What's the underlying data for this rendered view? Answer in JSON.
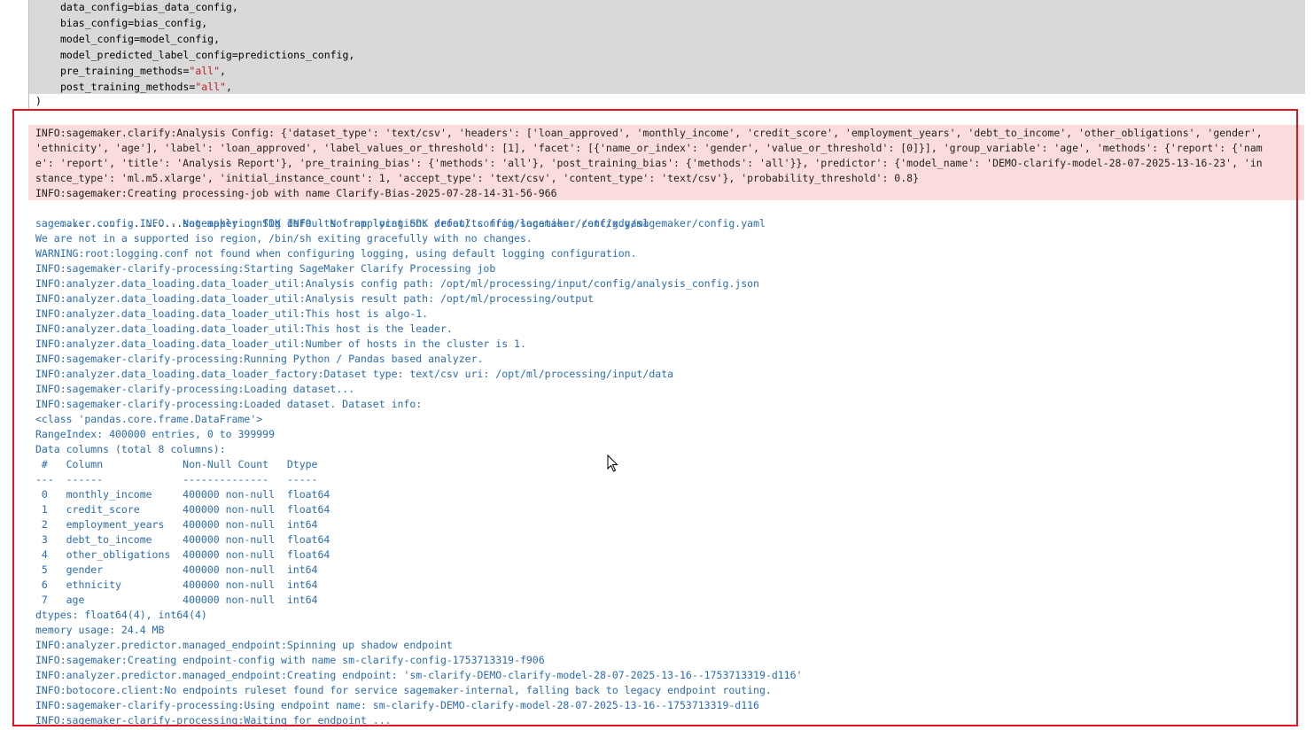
{
  "code_cell": {
    "lines": [
      {
        "prefix": "data_config=bias_data_config,",
        "str": "",
        "suffix": ""
      },
      {
        "prefix": "bias_config=bias_config,",
        "str": "",
        "suffix": ""
      },
      {
        "prefix": "model_config=model_config,",
        "str": "",
        "suffix": ""
      },
      {
        "prefix": "model_predicted_label_config=predictions_config,",
        "str": "",
        "suffix": ""
      },
      {
        "prefix": "pre_training_methods=",
        "str": "\"all\"",
        "suffix": ","
      },
      {
        "prefix": "post_training_methods=",
        "str": "\"all\"",
        "suffix": ","
      }
    ],
    "closing": ")"
  },
  "output": {
    "stderr_lines": [
      "INFO:sagemaker.clarify:Analysis Config: {'dataset_type': 'text/csv', 'headers': ['loan_approved', 'monthly_income', 'credit_score', 'employment_years', 'debt_to_income', 'other_obligations', 'gender',",
      "'ethnicity', 'age'], 'label': 'loan_approved', 'label_values_or_threshold': [1], 'facet': [{'name_or_index': 'gender', 'value_or_threshold': [0]}], 'group_variable': 'age', 'methods': {'report': {'nam",
      "e': 'report', 'title': 'Analysis Report'}, 'pre_training_bias': {'methods': 'all'}, 'post_training_bias': {'methods': 'all'}}, 'predictor': {'model_name': 'DEMO-clarify-model-28-07-2025-13-16-23', 'in",
      "stance_type': 'ml.m5.xlarge', 'initial_instance_count': 1, 'accept_type': 'text/csv', 'content_type': 'text/csv'}, 'probability_threshold': 0.8}",
      "INFO:sagemaker:Creating processing-job with name Clarify-Bias-2025-07-28-14-31-56-966"
    ],
    "progress_dots": "....................",
    "progress_tail": "sagemaker.config INFO - Not applying SDK defaults from location: /etc/xdg/sagemaker/config.yaml",
    "log_lines": [
      "sagemaker.config INFO - Not applying SDK defaults from location: /root/.config/sagemaker/config.yaml",
      "We are not in a supported iso region, /bin/sh exiting gracefully with no changes.",
      "WARNING:root:logging.conf not found when configuring logging, using default logging configuration.",
      "INFO:sagemaker-clarify-processing:Starting SageMaker Clarify Processing job",
      "INFO:analyzer.data_loading.data_loader_util:Analysis config path: /opt/ml/processing/input/config/analysis_config.json",
      "INFO:analyzer.data_loading.data_loader_util:Analysis result path: /opt/ml/processing/output",
      "INFO:analyzer.data_loading.data_loader_util:This host is algo-1.",
      "INFO:analyzer.data_loading.data_loader_util:This host is the leader.",
      "INFO:analyzer.data_loading.data_loader_util:Number of hosts in the cluster is 1.",
      "INFO:sagemaker-clarify-processing:Running Python / Pandas based analyzer.",
      "INFO:analyzer.data_loading.data_loader_factory:Dataset type: text/csv uri: /opt/ml/processing/input/data",
      "INFO:sagemaker-clarify-processing:Loading dataset...",
      "INFO:sagemaker-clarify-processing:Loaded dataset. Dataset info:",
      "<class 'pandas.core.frame.DataFrame'>",
      "RangeIndex: 400000 entries, 0 to 399999",
      "Data columns (total 8 columns):",
      " #   Column             Non-Null Count   Dtype  ",
      "---  ------             --------------   -----  ",
      " 0   monthly_income     400000 non-null  float64",
      " 1   credit_score       400000 non-null  float64",
      " 2   employment_years   400000 non-null  int64  ",
      " 3   debt_to_income     400000 non-null  float64",
      " 4   other_obligations  400000 non-null  float64",
      " 5   gender             400000 non-null  int64  ",
      " 6   ethnicity          400000 non-null  int64  ",
      " 7   age                400000 non-null  int64  ",
      "dtypes: float64(4), int64(4)",
      "memory usage: 24.4 MB",
      "INFO:analyzer.predictor.managed_endpoint:Spinning up shadow endpoint",
      "INFO:sagemaker:Creating endpoint-config with name sm-clarify-config-1753713319-f906",
      "INFO:analyzer.predictor.managed_endpoint:Creating endpoint: 'sm-clarify-DEMO-clarify-model-28-07-2025-13-16--1753713319-d116'",
      "INFO:botocore.client:No endpoints ruleset found for service sagemaker-internal, falling back to legacy endpoint routing.",
      "INFO:sagemaker-clarify-processing:Using endpoint name: sm-clarify-DEMO-clarify-model-28-07-2025-13-16--1753713319-d116",
      "INFO:sagemaker-clarify-processing:Waiting for endpoint ..."
    ]
  },
  "colors": {
    "highlight_border": "#e81123",
    "stderr_bg": "#fbdcdc",
    "log_text": "#2b6cb0",
    "code_bg": "#d9d9d9",
    "string_literal": "#ba2121"
  },
  "icons": {
    "cursor": "mouse-pointer-icon"
  }
}
